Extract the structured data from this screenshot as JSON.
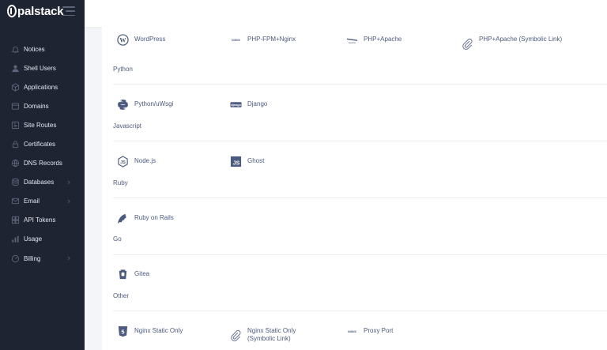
{
  "brand": {
    "name": "palstack"
  },
  "sidebar": {
    "items": [
      {
        "label": "Notices",
        "icon": "bell-icon",
        "chevron": false
      },
      {
        "label": "Shell Users",
        "icon": "users-icon",
        "chevron": false
      },
      {
        "label": "Applications",
        "icon": "cube-icon",
        "chevron": false
      },
      {
        "label": "Domains",
        "icon": "window-icon",
        "chevron": false
      },
      {
        "label": "Site Routes",
        "icon": "route-icon",
        "chevron": false
      },
      {
        "label": "Certificates",
        "icon": "lock-icon",
        "chevron": false
      },
      {
        "label": "DNS Records",
        "icon": "globe-icon",
        "chevron": false
      },
      {
        "label": "Databases",
        "icon": "database-icon",
        "chevron": true
      },
      {
        "label": "Email",
        "icon": "envelope-icon",
        "chevron": true
      },
      {
        "label": "API Tokens",
        "icon": "key-icon",
        "chevron": false
      },
      {
        "label": "Usage",
        "icon": "chart-icon",
        "chevron": false
      },
      {
        "label": "Billing",
        "icon": "credit-card-icon",
        "chevron": true
      }
    ]
  },
  "apps": {
    "wordpress": "WordPress",
    "php_fpm_nginx": "PHP-FPM+Nginx",
    "php_apache": "PHP+Apache",
    "php_apache_symlink": "PHP+Apache (Symbolic Link)",
    "python_uwsgi": "Python/uWsgi",
    "django": "Django",
    "nodejs": "Node.js",
    "ghost": "Ghost",
    "ruby_on_rails": "Ruby on Rails",
    "gitea": "Gitea",
    "nginx_static": "Nginx Static Only",
    "nginx_static_symlink": "Nginx Static Only (Symbolic Link)",
    "proxy_port": "Proxy Port"
  },
  "categories": {
    "python": "Python",
    "javascript": "Javascript",
    "ruby": "Ruby",
    "go": "Go",
    "other": "Other"
  },
  "icon_text": {
    "nginx": "NGINX",
    "django": "django",
    "js": "JS",
    "apache": "Apache"
  },
  "colors": {
    "sidebar_bg": "#1f2433",
    "text_accent": "#4b5a80",
    "icon_color": "#4b5a80"
  }
}
